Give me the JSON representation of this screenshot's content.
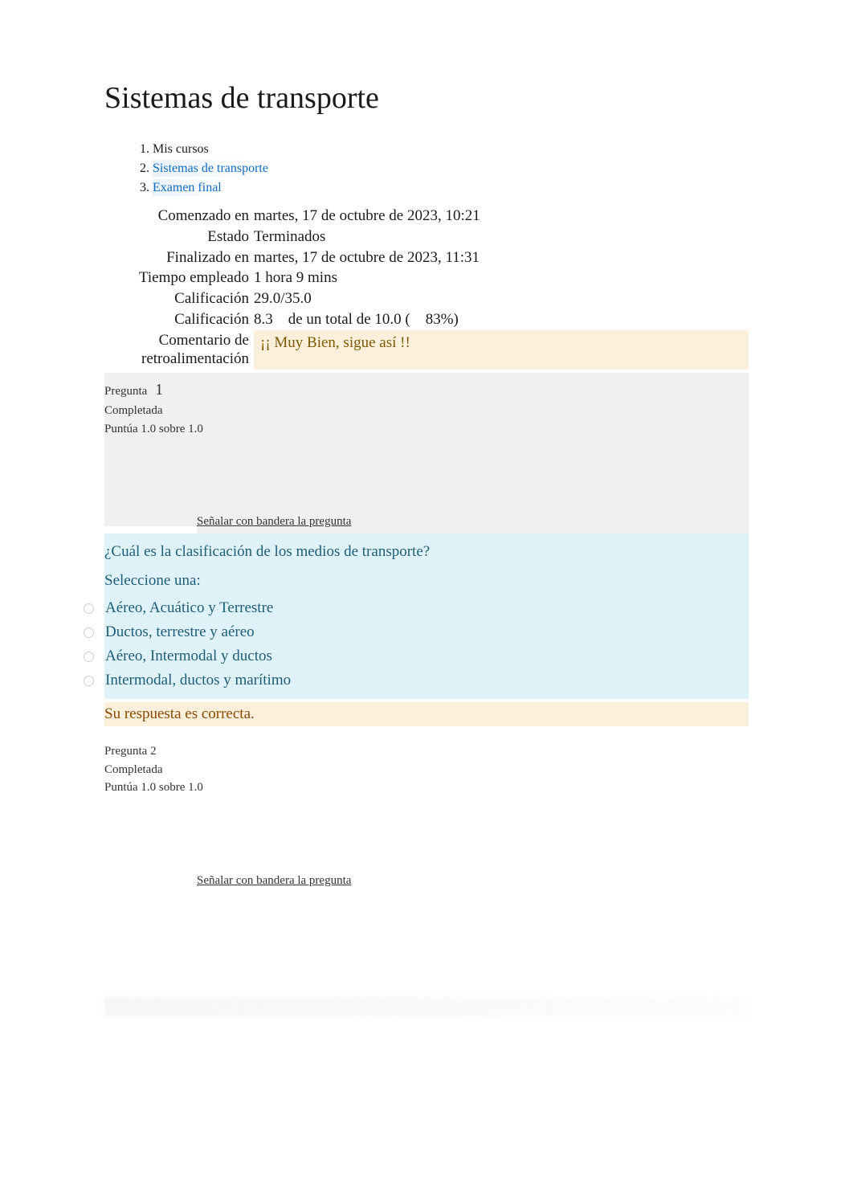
{
  "page_title": "Sistemas de transporte",
  "breadcrumb": {
    "items": [
      {
        "label": "Mis cursos",
        "link": false
      },
      {
        "label": "Sistemas de transporte",
        "link": true
      },
      {
        "label": "Examen final",
        "link": true
      }
    ]
  },
  "summary": {
    "started_label": "Comenzado en",
    "started_value": "martes, 17 de octubre de 2023, 10:21",
    "state_label": "Estado",
    "state_value": "Terminados",
    "finished_label": "Finalizado en",
    "finished_value": "martes, 17 de octubre de 2023, 11:31",
    "time_label": "Tiempo empleado",
    "time_value": "1 hora 9 mins",
    "grade1_label": "Calificación",
    "grade1_value": "29.0/35.0",
    "grade2_label": "Calificación",
    "grade2_value": "8.3 de un total de 10.0 ( 83%)",
    "feedback_label": "Comentario de retroalimentación",
    "feedback_value": "¡¡ Muy Bien, sigue así !!"
  },
  "q1": {
    "label": "Pregunta",
    "number": "1",
    "status": "Completada",
    "mark": "Puntúa 1.0 sobre 1.0",
    "flag": "Señalar con bandera la pregunta",
    "text": "¿Cuál es la clasificación de los medios de transporte?",
    "prompt": "Seleccione una:",
    "answers": [
      "Aéreo, Acuático y Terrestre",
      "Ductos, terrestre y aéreo",
      "Aéreo, Intermodal y ductos",
      "Intermodal, ductos y marítimo"
    ],
    "feedback": "Su respuesta es correcta."
  },
  "q2": {
    "label": "Pregunta",
    "number": "2",
    "status": "Completada",
    "mark": "Puntúa 1.0 sobre 1.0",
    "flag": "Señalar con bandera la pregunta"
  }
}
